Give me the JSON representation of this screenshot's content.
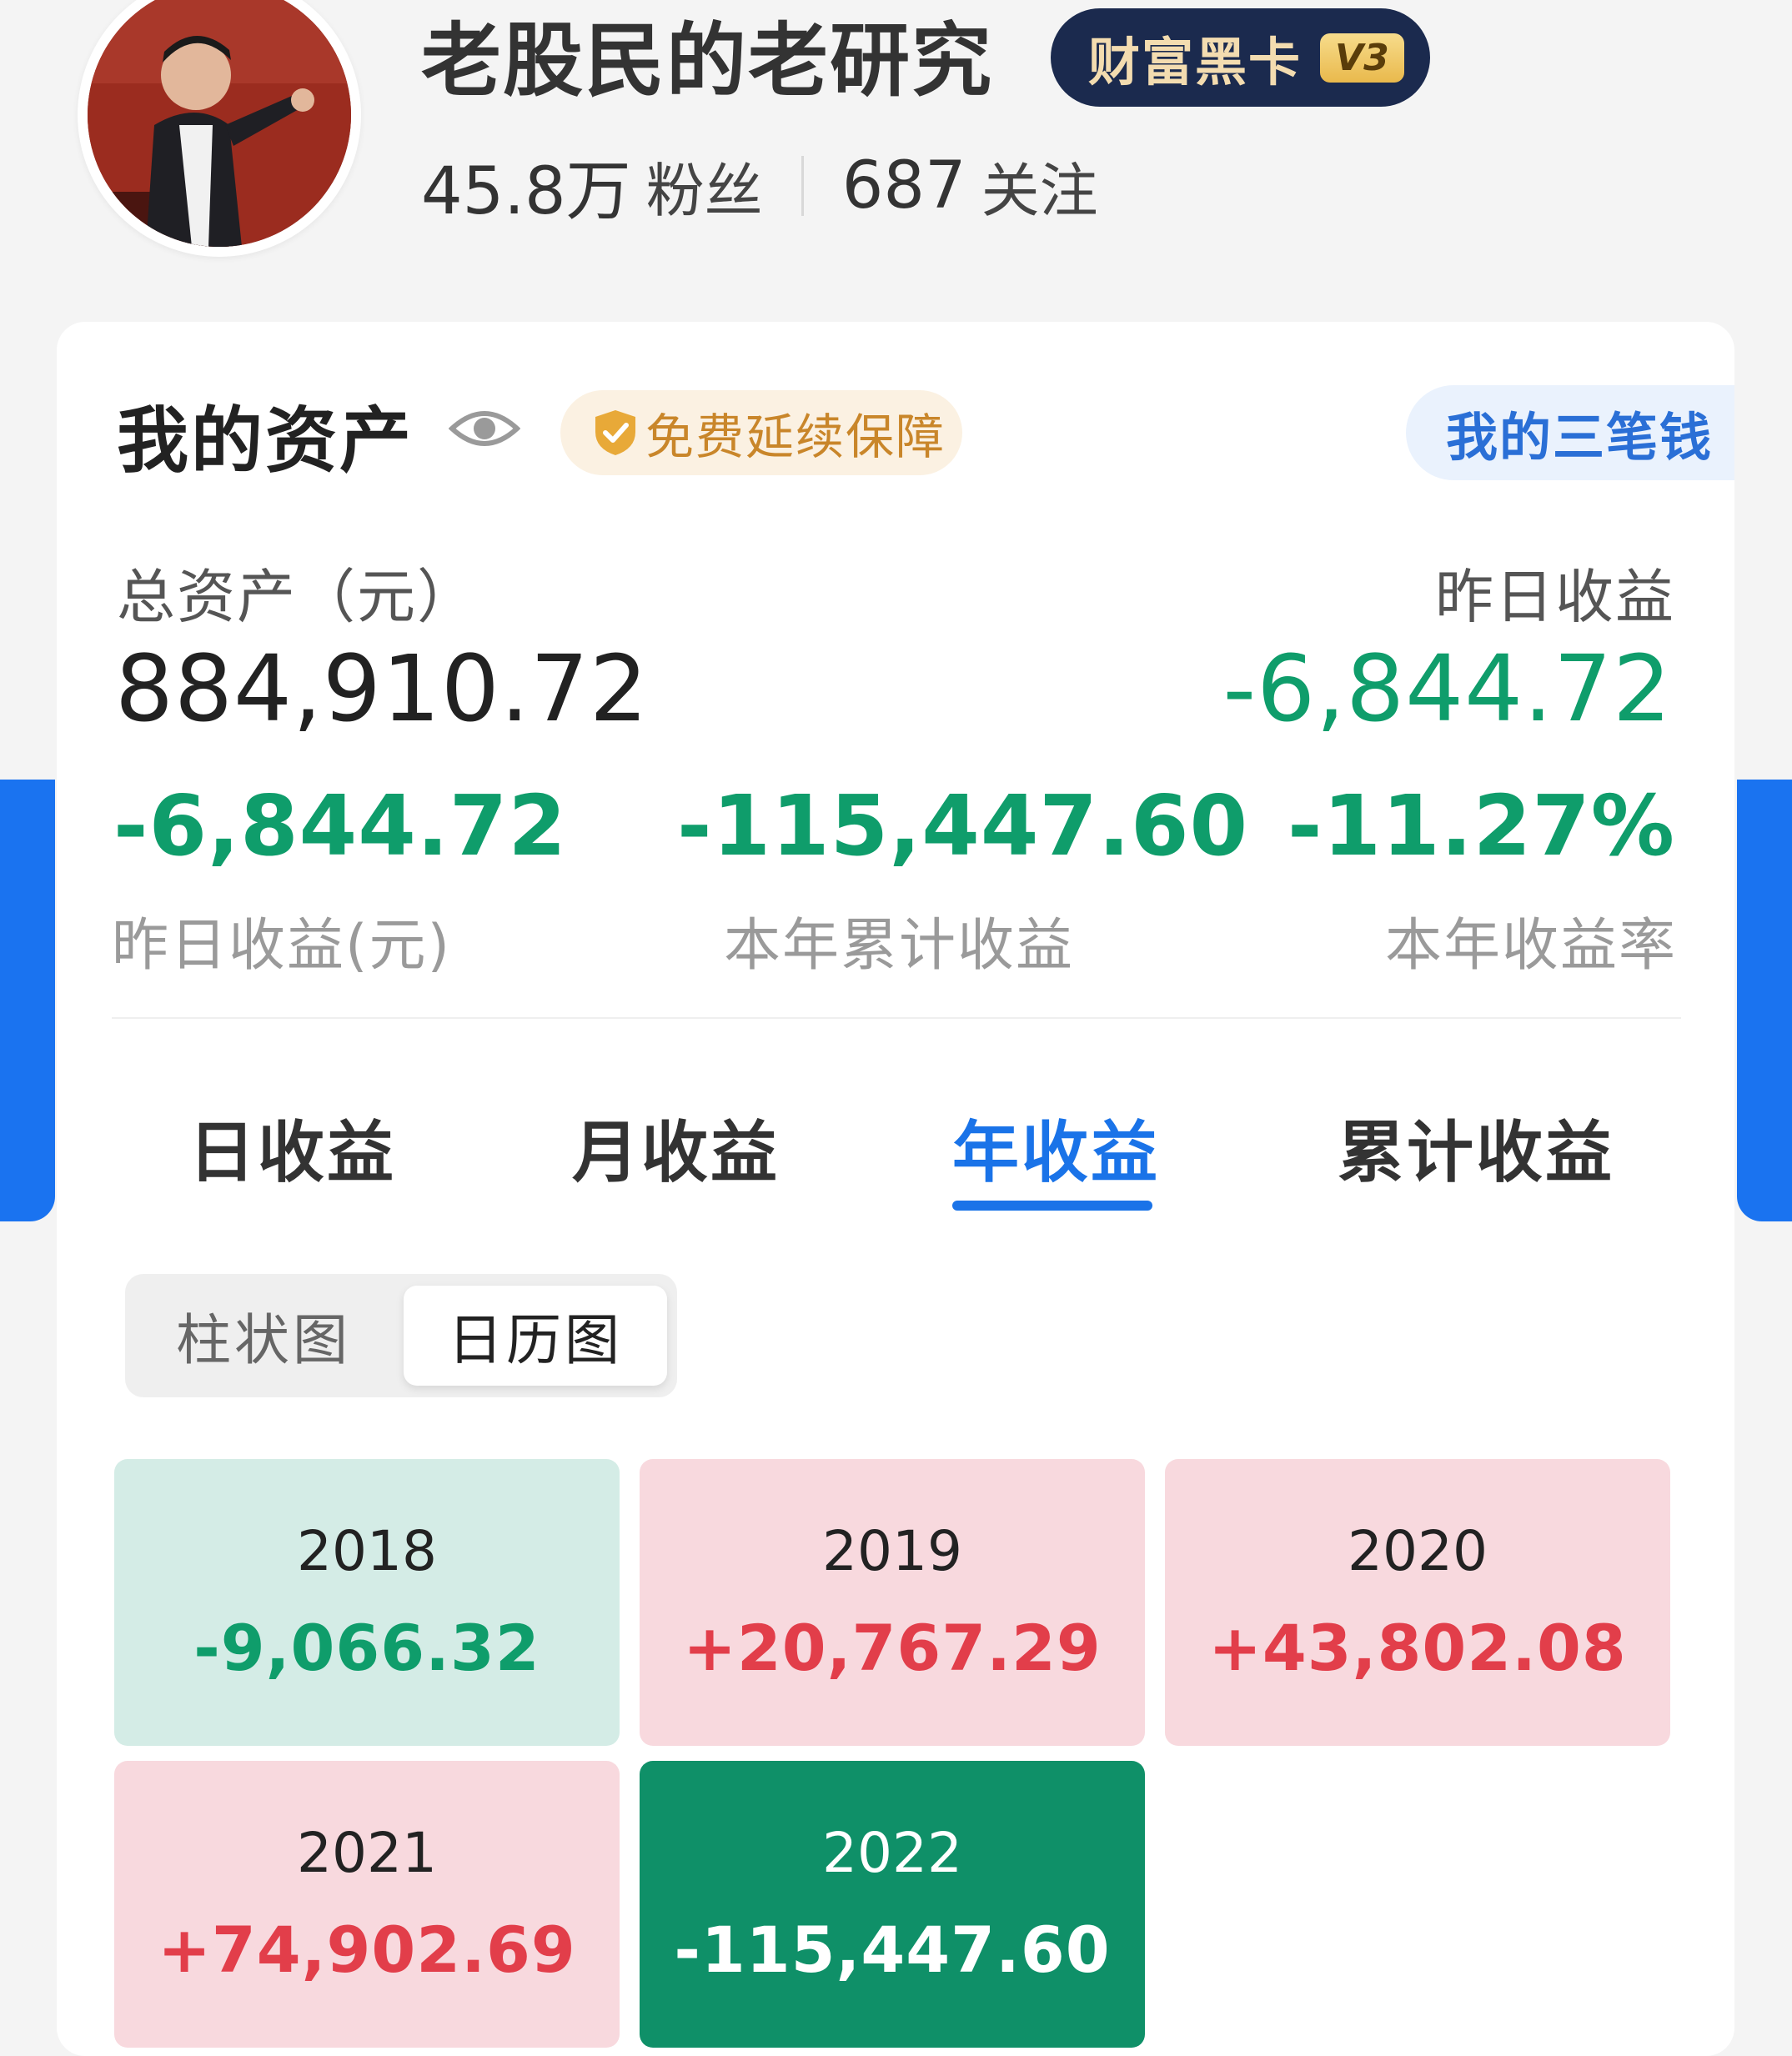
{
  "profile": {
    "username": "老股民的老研究",
    "vip_badge_text": "财富黑卡",
    "vip_level": "V3",
    "followers_count": "45.8万",
    "followers_label": "粉丝",
    "following_count": "687",
    "following_label": "关注"
  },
  "assets": {
    "title": "我的资产",
    "protect_badge": "免费延续保障",
    "three_money_button": "我的三笔钱",
    "total_label": "总资产（元）",
    "total_value": "884,910.72",
    "yesterday_label_right": "昨日收益",
    "yesterday_value_right": "-6,844.72",
    "metrics": [
      {
        "value": "-6,844.72",
        "label": "昨日收益(元)"
      },
      {
        "value": "-115,447.60",
        "label": "本年累计收益"
      },
      {
        "value": "-11.27%",
        "label": "本年收益率"
      }
    ]
  },
  "tabs": [
    {
      "label": "日收益",
      "active": false
    },
    {
      "label": "月收益",
      "active": false
    },
    {
      "label": "年收益",
      "active": true
    },
    {
      "label": "累计收益",
      "active": false
    }
  ],
  "view_toggle": {
    "options": [
      "柱状图",
      "日历图"
    ],
    "selected": "日历图"
  },
  "year_tiles": [
    {
      "year": "2018",
      "value": "-9,066.32",
      "status": "loss"
    },
    {
      "year": "2019",
      "value": "+20,767.29",
      "status": "gain"
    },
    {
      "year": "2020",
      "value": "+43,802.08",
      "status": "gain"
    },
    {
      "year": "2021",
      "value": "+74,902.69",
      "status": "gain"
    },
    {
      "year": "2022",
      "value": "-115,447.60",
      "status": "big-loss"
    }
  ],
  "colors": {
    "accent_blue": "#1a73e8",
    "loss_green": "#0f9d6b",
    "gain_red": "#e23e4a",
    "vip_navy": "#1b2a4e"
  }
}
